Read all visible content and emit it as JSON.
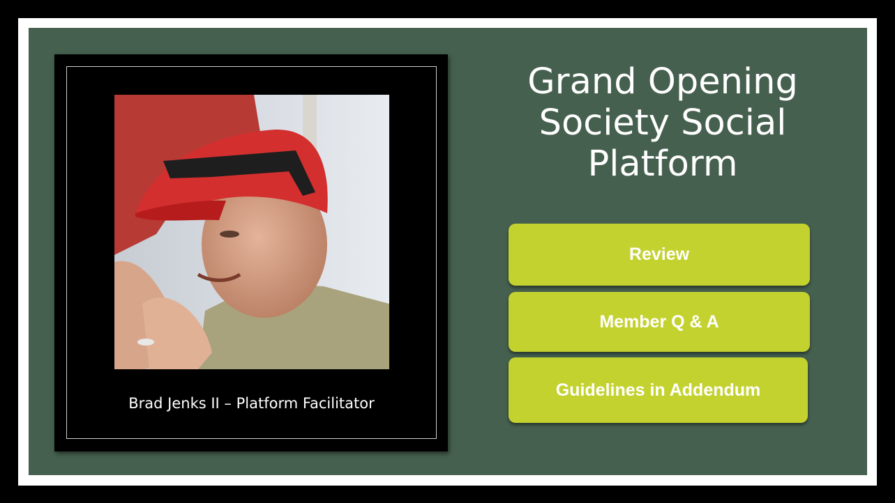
{
  "slide": {
    "title_lines": [
      "Grand Opening",
      "Society Social",
      "Platform"
    ],
    "caption": "Brad Jenks II – Platform Facilitator",
    "buttons": [
      "Review",
      "Member Q & A",
      "Guidelines in Addendum"
    ],
    "photo_icon": "portrait-photo",
    "colors": {
      "background": "#46604f",
      "button": "#c4d230",
      "frame": "#000000",
      "text": "#ffffff"
    }
  }
}
